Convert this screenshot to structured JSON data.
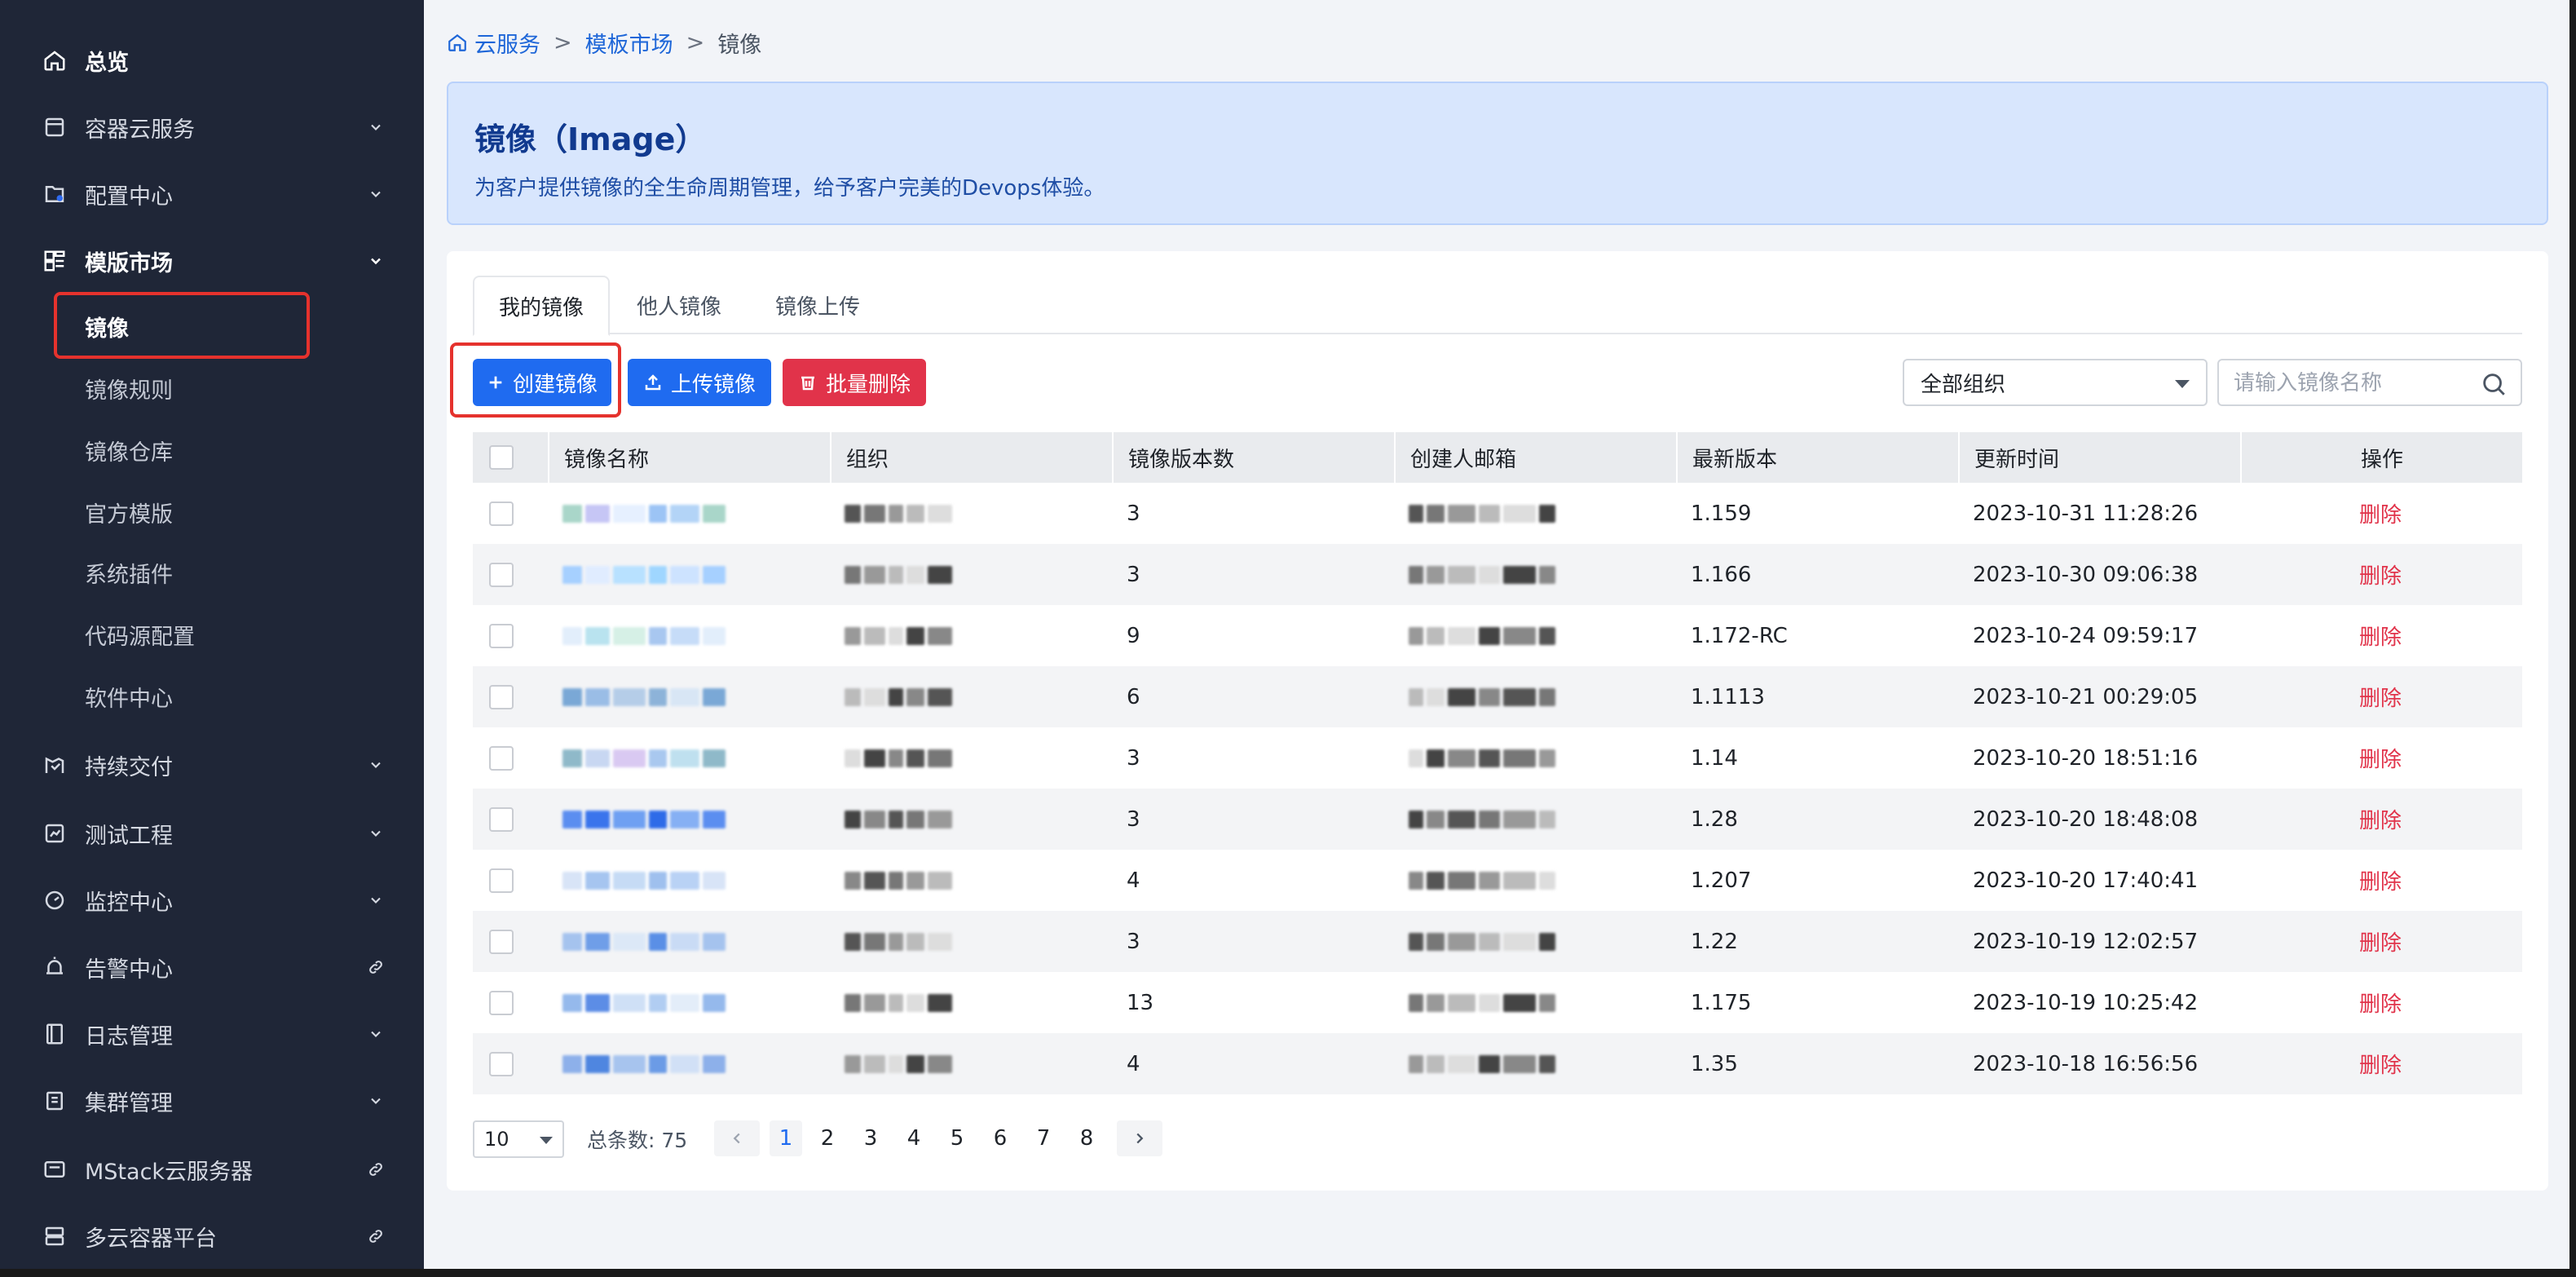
{
  "sidebar": {
    "items": [
      {
        "label": "总览",
        "icon": "home-icon",
        "arrow": "none",
        "bold": true
      },
      {
        "label": "容器云服务",
        "icon": "container-icon",
        "arrow": "chevron-down"
      },
      {
        "label": "配置中心",
        "icon": "config-icon",
        "arrow": "chevron-down"
      },
      {
        "label": "模版市场",
        "icon": "template-icon",
        "arrow": "chevron-down",
        "bold": true,
        "expanded": true
      },
      {
        "label": "持续交付",
        "icon": "delivery-icon",
        "arrow": "chevron-down"
      },
      {
        "label": "测试工程",
        "icon": "test-icon",
        "arrow": "chevron-down"
      },
      {
        "label": "监控中心",
        "icon": "monitor-icon",
        "arrow": "chevron-down"
      },
      {
        "label": "告警中心",
        "icon": "alarm-icon",
        "arrow": "link"
      },
      {
        "label": "日志管理",
        "icon": "log-icon",
        "arrow": "chevron-down"
      },
      {
        "label": "集群管理",
        "icon": "cluster-icon",
        "arrow": "chevron-down"
      },
      {
        "label": "MStack云服务器",
        "icon": "server-icon",
        "arrow": "link"
      },
      {
        "label": "多云容器平台",
        "icon": "multicloud-icon",
        "arrow": "link"
      }
    ],
    "sub_items": [
      {
        "label": "镜像",
        "active": true
      },
      {
        "label": "镜像规则"
      },
      {
        "label": "镜像仓库"
      },
      {
        "label": "官方模版"
      },
      {
        "label": "系统插件"
      },
      {
        "label": "代码源配置"
      },
      {
        "label": "软件中心"
      }
    ]
  },
  "breadcrumb": {
    "root": "云服务",
    "sep1": ">",
    "parent": "模板市场",
    "sep2": ">",
    "current": "镜像"
  },
  "banner": {
    "title": "镜像（Image）",
    "description": "为客户提供镜像的全生命周期管理，给予客户完美的Devops体验。"
  },
  "tabs": [
    {
      "label": "我的镜像",
      "active": true
    },
    {
      "label": "他人镜像"
    },
    {
      "label": "镜像上传"
    }
  ],
  "toolbar": {
    "create_label": "创建镜像",
    "upload_label": "上传镜像",
    "batch_delete_label": "批量删除",
    "org_select_value": "全部组织",
    "search_placeholder": "请输入镜像名称"
  },
  "table": {
    "headers": [
      "镜像名称",
      "组织",
      "镜像版本数",
      "创建人邮箱",
      "最新版本",
      "更新时间",
      "操作"
    ],
    "rows": [
      {
        "versions": "3",
        "latest": "1.159",
        "updated": "2023-10-31 11:28:26",
        "action": "删除"
      },
      {
        "versions": "3",
        "latest": "1.166",
        "updated": "2023-10-30 09:06:38",
        "action": "删除"
      },
      {
        "versions": "9",
        "latest": "1.172-RC",
        "updated": "2023-10-24 09:59:17",
        "action": "删除"
      },
      {
        "versions": "6",
        "latest": "1.1113",
        "updated": "2023-10-21 00:29:05",
        "action": "删除"
      },
      {
        "versions": "3",
        "latest": "1.14",
        "updated": "2023-10-20 18:51:16",
        "action": "删除"
      },
      {
        "versions": "3",
        "latest": "1.28",
        "updated": "2023-10-20 18:48:08",
        "action": "删除"
      },
      {
        "versions": "4",
        "latest": "1.207",
        "updated": "2023-10-20 17:40:41",
        "action": "删除"
      },
      {
        "versions": "3",
        "latest": "1.22",
        "updated": "2023-10-19 12:02:57",
        "action": "删除"
      },
      {
        "versions": "13",
        "latest": "1.175",
        "updated": "2023-10-19 10:25:42",
        "action": "删除"
      },
      {
        "versions": "4",
        "latest": "1.35",
        "updated": "2023-10-18 16:56:56",
        "action": "删除"
      }
    ]
  },
  "pagination": {
    "page_size": "10",
    "total_label": "总条数: 75",
    "pages": [
      "1",
      "2",
      "3",
      "4",
      "5",
      "6",
      "7",
      "8"
    ],
    "current_page": "1"
  },
  "colors": {
    "sidebar_bg": "#1f2637",
    "primary": "#1f6bf0",
    "danger": "#e1334a",
    "highlight": "#e5322d",
    "banner_bg": "#d8e6fd"
  }
}
